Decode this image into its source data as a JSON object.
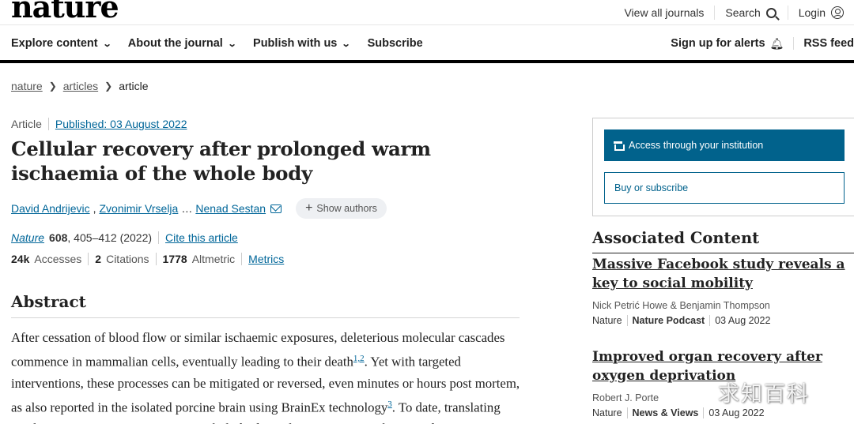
{
  "header": {
    "logo": "nature",
    "links": {
      "view_all": "View all journals",
      "search": "Search",
      "login": "Login"
    }
  },
  "nav": {
    "items": [
      {
        "label": "Explore content"
      },
      {
        "label": "About the journal"
      },
      {
        "label": "Publish with us"
      },
      {
        "label": "Subscribe"
      }
    ],
    "alerts": "Sign up for alerts",
    "rss": "RSS feed"
  },
  "breadcrumb": {
    "home": "nature",
    "section": "articles",
    "current": "article"
  },
  "article": {
    "type": "Article",
    "published": "Published: 03 August 2022",
    "title": "Cellular recovery after prolonged warm ischaemia of the whole body",
    "authors": {
      "first": "David Andrijevic",
      "second": "Zvonimir Vrselja",
      "ellipsis": "…",
      "last": "Nenad Sestan",
      "show_authors": "Show authors"
    },
    "journal": {
      "name": "Nature",
      "volume": "608",
      "pages": ", 405–412 (2022)",
      "cite": "Cite this article"
    },
    "metrics": {
      "accesses_value": "24k",
      "accesses_label": "Accesses",
      "citations_value": "2",
      "citations_label": "Citations",
      "altmetric_value": "1778",
      "altmetric_label": "Altmetric",
      "metrics_link": "Metrics"
    },
    "abstract": {
      "heading": "Abstract",
      "p1": "After cessation of blood flow or similar ischaemic exposures, deleterious molecular cascades commence in mammalian cells, eventually leading to their death",
      "ref1": "1,2",
      "p2": ". Yet with targeted interventions, these processes can be mitigated or reversed, even minutes or hours post mortem, as also reported in the isolated porcine brain using BrainEx technology",
      "ref2": "3",
      "p3": ". To date, translating single-organ interventions to intact, whole-body applications remains hampered"
    }
  },
  "sidebar": {
    "access_button": "Access through your institution",
    "buy_button": "Buy or subscribe",
    "associated_heading": "Associated Content",
    "items": [
      {
        "title": "Massive Facebook study reveals a key to social mobility",
        "authors": "Nick Petrić Howe & Benjamin Thompson",
        "journal": "Nature",
        "kind": "Nature Podcast",
        "date": "03 Aug 2022"
      },
      {
        "title": "Improved organ recovery after oxygen deprivation",
        "authors": "Robert J. Porte",
        "journal": "Nature",
        "kind": "News & Views",
        "date": "03 Aug 2022"
      }
    ]
  },
  "watermark": "求知百科",
  "colors": {
    "link": "#006699",
    "access_button_bg": "#01628c",
    "nav_rule": "#000000"
  }
}
